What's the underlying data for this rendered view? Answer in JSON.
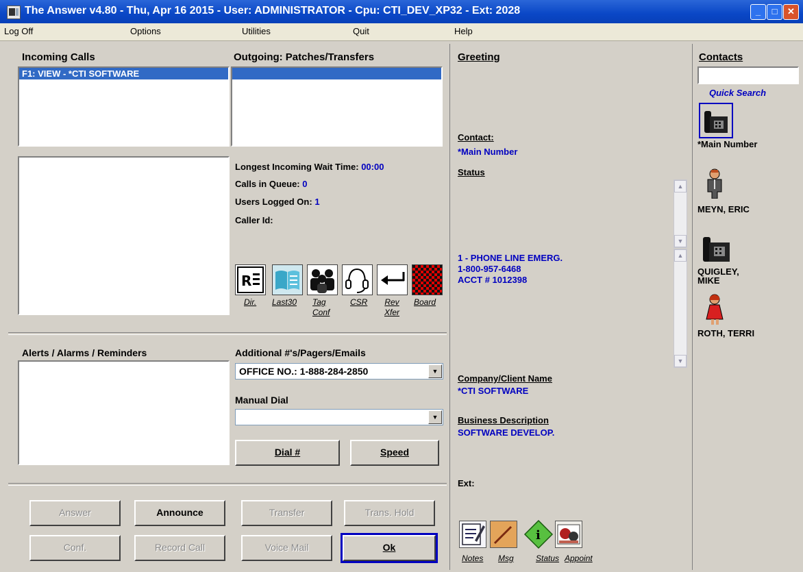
{
  "window": {
    "title": "The Answer v4.80 - Thu, Apr 16 2015 - User: ADMINISTRATOR - Cpu: CTI_DEV_XP32 - Ext: 2028"
  },
  "menu": [
    "Log Off",
    "Options",
    "Utilities",
    "Quit",
    "Help"
  ],
  "incoming": {
    "header": "Incoming Calls",
    "items": [
      "F1:  VIEW - *CTI SOFTWARE"
    ]
  },
  "outgoing": {
    "header": "Outgoing:  Patches/Transfers"
  },
  "stats": {
    "wait_label": "Longest Incoming Wait Time:",
    "wait_value": "00:00",
    "queue_label": "Calls in Queue:",
    "queue_value": "0",
    "users_label": "Users Logged On:",
    "users_value": "1",
    "callerid_label": "Caller Id:"
  },
  "tools": [
    {
      "icon": "directory-icon",
      "label": "Dir."
    },
    {
      "icon": "last30-book-icon",
      "label": "Last30"
    },
    {
      "icon": "tag-conference-icon",
      "label": "Tag\nConf"
    },
    {
      "icon": "headset-csr-icon",
      "label": "CSR"
    },
    {
      "icon": "reverse-transfer-arrow-icon",
      "label": "Rev\nXfer"
    },
    {
      "icon": "board-checker-icon",
      "label": "Board"
    }
  ],
  "alerts": {
    "header": "Alerts / Alarms / Reminders"
  },
  "additional": {
    "header": "Additional #'s/Pagers/Emails",
    "value": "OFFICE NO.: 1-888-284-2850"
  },
  "manual_dial": {
    "header": "Manual Dial",
    "value": ""
  },
  "dial_buttons": {
    "dial": "Dial #",
    "speed": "Speed"
  },
  "actions": {
    "answer": "Answer",
    "announce": "Announce",
    "transfer": "Transfer",
    "trans_hold": "Trans. Hold",
    "conf": "Conf.",
    "record": "Record Call",
    "voicemail": "Voice Mail",
    "ok": "Ok"
  },
  "greeting": {
    "header": "Greeting",
    "contact_label": "Contact:",
    "contact_value": "*Main Number",
    "status_label": "Status",
    "notes": [
      "1 - PHONE LINE EMERG.",
      "1-800-957-6468",
      "ACCT # 1012398"
    ],
    "company_label": "Company/Client Name",
    "company_value": "*CTI SOFTWARE",
    "business_label": "Business Description",
    "business_value": "SOFTWARE DEVELOP.",
    "ext_label": "Ext:"
  },
  "bottom_tools": [
    {
      "icon": "notes-icon",
      "label": "Notes"
    },
    {
      "icon": "message-icon",
      "label": "Msg"
    },
    {
      "icon": "status-info-icon",
      "label": "Status"
    },
    {
      "icon": "appointment-icon",
      "label": "Appoint"
    }
  ],
  "contacts": {
    "header": "Contacts",
    "search_value": "",
    "quick_search": "Quick Search",
    "items": [
      "*Main Number",
      "MEYN, ERIC",
      "QUIGLEY,\nMIKE",
      "ROTH, TERRI"
    ]
  },
  "colors": {
    "title_bar": "#0a47c6",
    "selection": "#316ac5",
    "value_text": "#0000c0",
    "face": "#d4d0c8"
  }
}
